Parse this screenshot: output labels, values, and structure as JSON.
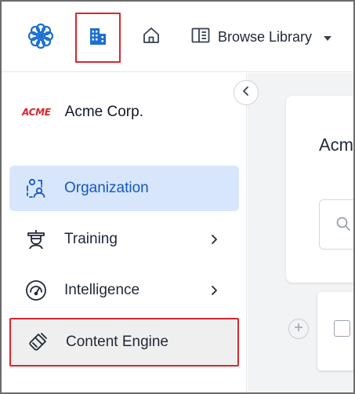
{
  "topbar": {
    "logo_icon": "flower-logo-icon",
    "org_icon": "building-icon",
    "home_icon": "home-icon",
    "browse_library": {
      "icon": "book-panel-icon",
      "label": "Browse Library",
      "caret": "caret-down-icon"
    }
  },
  "sidebar": {
    "collapse_icon": "chevron-left-icon",
    "company": {
      "logo_text": "ACME",
      "name": "Acme Corp."
    },
    "items": [
      {
        "label": "Organization",
        "icon": "people-network-icon",
        "active": true,
        "has_chevron": false
      },
      {
        "label": "Training",
        "icon": "graduate-icon",
        "active": false,
        "has_chevron": true
      },
      {
        "label": "Intelligence",
        "icon": "gauge-icon",
        "active": false,
        "has_chevron": true
      },
      {
        "label": "Content Engine",
        "icon": "paintbrush-icon",
        "active": false,
        "has_chevron": false
      }
    ]
  },
  "main": {
    "card_title": "Acm",
    "search_icon": "search-icon",
    "add_icon": "plus-icon"
  },
  "colors": {
    "accent_blue": "#1558c0",
    "active_bg": "#d7e6fb",
    "highlight_red": "#d9262d",
    "logo_blue": "#1a6fd1"
  }
}
